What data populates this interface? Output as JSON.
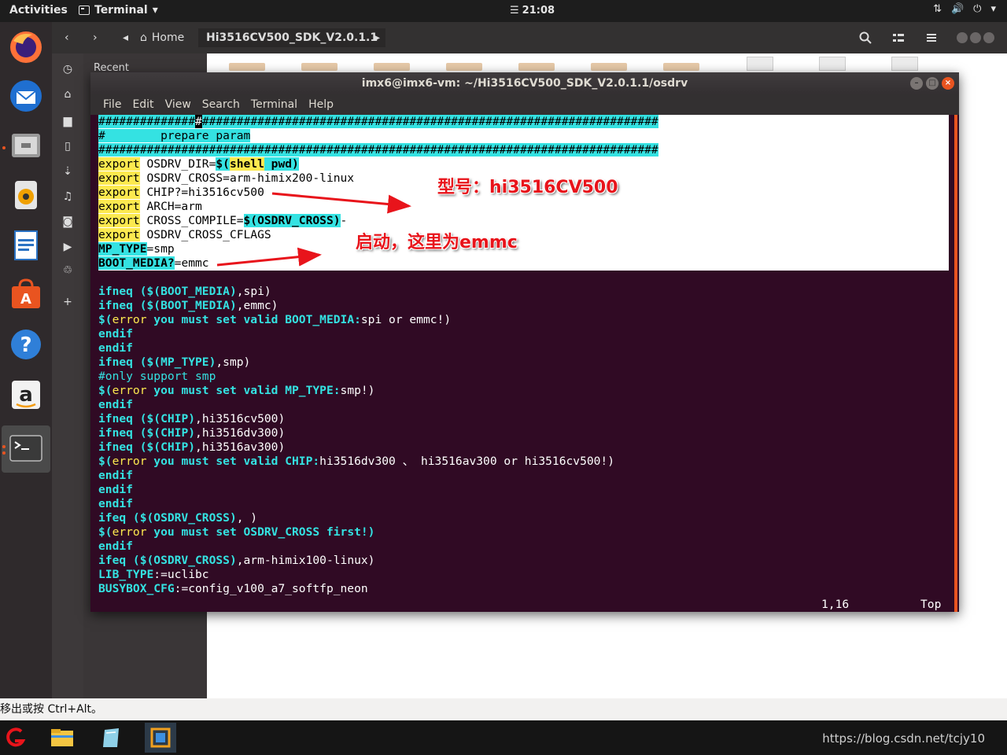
{
  "topbar": {
    "activities": "Activities",
    "app_name": "Terminal",
    "app_arrow": "▾",
    "clock_icon": "☰",
    "clock": "21:08",
    "tray": {
      "network": "⇅",
      "volume": "🔊",
      "power": "⏻",
      "arrow": "▾"
    }
  },
  "dock": {
    "items": [
      "firefox",
      "thunderbird",
      "files",
      "rhythmbox",
      "libreoffice-writer",
      "software-center",
      "help",
      "amazon",
      "terminal"
    ]
  },
  "file_manager": {
    "nav_back": "‹",
    "nav_forward": "›",
    "path_left": "◂",
    "home_label": "Home",
    "current_folder": "Hi3516CV500_SDK_V2.0.1.1",
    "path_right": "▸",
    "sidebar": {
      "recent": "Recent",
      "other_letters": [
        "H",
        "D",
        "D",
        "D",
        "M",
        "P",
        "V",
        "T",
        "O"
      ]
    }
  },
  "terminal": {
    "title": "imx6@imx6-vm: ~/Hi3516CV500_SDK_V2.0.1.1/osdrv",
    "menu": [
      "File",
      "Edit",
      "View",
      "Search",
      "Terminal",
      "Help"
    ],
    "lines": {
      "l1": "##############",
      "l1_cursor": "#",
      "l1_rest": "##################################################################",
      "l2": "#        prepare param",
      "l3": "#################################################################################",
      "l4_kw": "export",
      "l4_a": " OSDRV_DIR=",
      "l4_b": "$(",
      "l4_c": "shell",
      "l4_d": " pwd)",
      "l5_kw": "export",
      "l5_a": " OSDRV_CROSS=arm-himix200-linux",
      "l6_kw": "export",
      "l6_a": " CHIP?=hi3516cv500",
      "l7_kw": "export",
      "l7_a": " ARCH=arm",
      "l8_kw": "export",
      "l8_a": " CROSS_COMPILE=",
      "l8_b": "$(OSDRV_CROSS)",
      "l8_c": "-",
      "l9_kw": "export",
      "l9_a": " OSDRV_CROSS_CFLAGS",
      "l10_a": "MP_TYPE",
      "l10_b": "=smp",
      "l11_a": "BOOT_MEDIA?",
      "l11_b": "=emmc",
      "l12_a": "ifneq (",
      "l12_b": "$(BOOT_MEDIA)",
      "l12_c": ",spi)",
      "l13_a": "ifneq (",
      "l13_b": "$(BOOT_MEDIA)",
      "l13_c": ",emmc)",
      "l14_a": "$(",
      "l14_b": "error",
      "l14_c": " you must set valid BOOT_MEDIA:",
      "l14_d": "spi or emmc!)",
      "l15": "endif",
      "l16": "endif",
      "l17_a": "ifneq (",
      "l17_b": "$(MP_TYPE)",
      "l17_c": ",smp)",
      "l18": "#only support smp",
      "l19_a": "$(",
      "l19_b": "error",
      "l19_c": " you must set valid MP_TYPE:",
      "l19_d": "smp!)",
      "l20": "endif",
      "l21_a": "ifneq (",
      "l21_b": "$(CHIP)",
      "l21_c": ",hi3516cv500)",
      "l22_a": "ifneq (",
      "l22_b": "$(CHIP)",
      "l22_c": ",hi3516dv300)",
      "l23_a": "ifneq (",
      "l23_b": "$(CHIP)",
      "l23_c": ",hi3516av300)",
      "l24_a": "$(",
      "l24_b": "error",
      "l24_c": " you must set valid CHIP:",
      "l24_d": "hi3516dv300 、 hi3516av300 or hi3516cv500!)",
      "l25": "endif",
      "l26": "endif",
      "l27": "endif",
      "l28_a": "ifeq (",
      "l28_b": "$(OSDRV_CROSS)",
      "l28_c": ", )",
      "l29_a": "$(",
      "l29_b": "error",
      "l29_c": " you must set OSDRV_CROSS first!)",
      "l30": "endif",
      "l31_a": "ifeq (",
      "l31_b": "$(OSDRV_CROSS)",
      "l31_c": ",arm-himix100-linux)",
      "l32_a": "LIB_TYPE",
      "l32_b": ":=uclibc",
      "l33_a": "BUSYBOX_CFG",
      "l33_b": ":=config_v100_a7_softfp_neon"
    },
    "status_pos": "1,16",
    "status_top": "Top"
  },
  "annotations": {
    "chip": "型号：hi3516CV500",
    "boot": "启动，这里为emmc"
  },
  "hint": "移出或按 Ctrl+Alt。",
  "watermark": "https://blog.csdn.net/tcjy10",
  "colors": {
    "accent": "#e95420",
    "term_bg": "#300a24",
    "cyan": "#34e2e2",
    "yellow": "#fce94f",
    "annotation": "#e8141b"
  }
}
